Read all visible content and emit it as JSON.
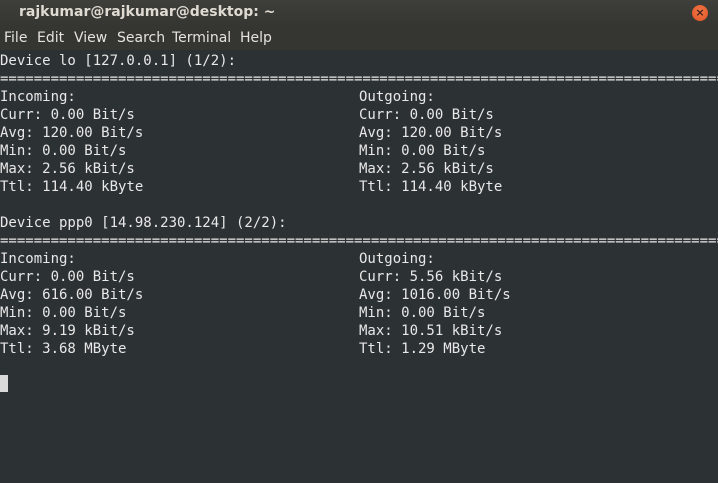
{
  "window": {
    "title": "rajkumar@rajkumar@desktop: ~",
    "close_glyph": "×"
  },
  "menu": [
    "File",
    "Edit",
    "View",
    "Search",
    "Terminal",
    "Help"
  ],
  "terminal": {
    "separator": "==================================================================================================================================",
    "devices": [
      {
        "header": "Device lo [127.0.0.1] (1/2):",
        "incoming_label": "Incoming:",
        "outgoing_label": "Outgoing:",
        "incoming": [
          "Curr: 0.00 Bit/s",
          "Avg: 120.00 Bit/s",
          "Min: 0.00 Bit/s",
          "Max: 2.56 kBit/s",
          "Ttl: 114.40 kByte"
        ],
        "outgoing": [
          "Curr: 0.00 Bit/s",
          "Avg: 120.00 Bit/s",
          "Min: 0.00 Bit/s",
          "Max: 2.56 kBit/s",
          "Ttl: 114.40 kByte"
        ]
      },
      {
        "header": "Device ppp0 [14.98.230.124] (2/2):",
        "incoming_label": "Incoming:",
        "outgoing_label": "Outgoing:",
        "incoming": [
          "Curr: 0.00 Bit/s",
          "Avg: 616.00 Bit/s",
          "Min: 0.00 Bit/s",
          "Max: 9.19 kBit/s",
          "Ttl: 3.68 MByte"
        ],
        "outgoing": [
          "Curr: 5.56 kBit/s",
          "Avg: 1016.00 Bit/s",
          "Min: 0.00 Bit/s",
          "Max: 10.51 kBit/s",
          "Ttl: 1.29 MByte"
        ]
      }
    ]
  }
}
